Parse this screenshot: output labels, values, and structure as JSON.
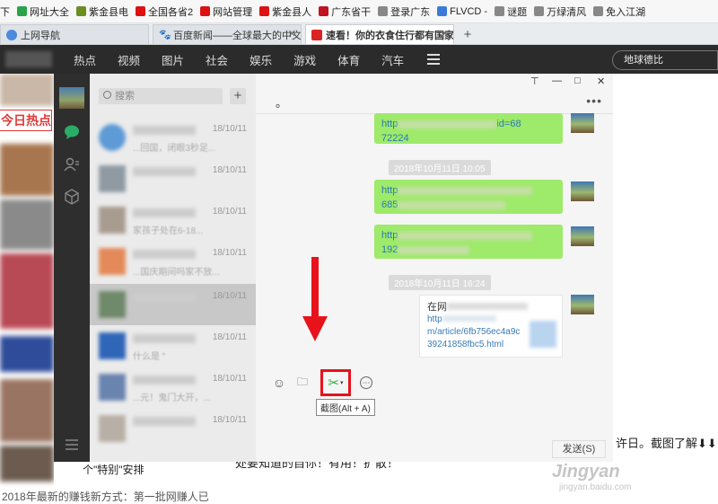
{
  "bookmarks": {
    "items": [
      {
        "label": "下",
        "color": "#e58a1f"
      },
      {
        "label": "网址大全",
        "color": "#2aa34a"
      },
      {
        "label": "紫金县电",
        "color": "#6b8e23"
      },
      {
        "label": "全国各省2",
        "color": "#d11"
      },
      {
        "label": "网站管理",
        "color": "#d11"
      },
      {
        "label": "紫金县人",
        "color": "#d11"
      },
      {
        "label": "广东省干",
        "color": "#c1121f"
      },
      {
        "label": "登录广东",
        "color": "#888"
      },
      {
        "label": "FLVCD -",
        "color": "#3b7bd8"
      },
      {
        "label": "谜题",
        "color": "#888"
      },
      {
        "label": "万绿清风",
        "color": "#888"
      },
      {
        "label": "免入江湖",
        "color": "#888"
      }
    ]
  },
  "tabs": {
    "items": [
      {
        "label": "上网导航",
        "active": false
      },
      {
        "label": "百度新闻——全球最大的中文新",
        "active": false
      },
      {
        "label": "速看！你的衣食住行都有国家标准",
        "active": true
      }
    ],
    "new_tab": "+"
  },
  "site_nav": {
    "items": [
      "热点",
      "视频",
      "图片",
      "社会",
      "娱乐",
      "游戏",
      "体育",
      "汽车"
    ],
    "search_placeholder": "地球德比"
  },
  "left_news": {
    "today_label": "今日热点",
    "bottom_lines": [
      "个\"特别\"安排",
      "2018年最新的赚钱新方式：第一批网赚人已"
    ]
  },
  "wechat": {
    "search_placeholder": "搜索",
    "add_label": "+",
    "chats": [
      {
        "time": "18/10/11",
        "preview": "...回国，闭眼3秒足..."
      },
      {
        "time": "18/10/11",
        "preview": ""
      },
      {
        "time": "18/10/11",
        "preview": "家孩子处在6-18..."
      },
      {
        "time": "18/10/11",
        "preview": "...国庆期间吗家不放..."
      },
      {
        "time": "18/10/11",
        "preview": ""
      },
      {
        "time": "18/10/11",
        "preview": "什么是 \""
      },
      {
        "time": "18/10/11",
        "preview": "...元！鬼门大开，..."
      },
      {
        "time": "18/10/11",
        "preview": ""
      }
    ],
    "window_controls": {
      "pin": "⊤",
      "min": "—",
      "max": "□",
      "close": "✕"
    },
    "chat_title": "。",
    "more": "•••",
    "messages": [
      {
        "type": "link",
        "text": "http",
        "suffix": "id=68",
        "line2": "72224"
      },
      {
        "type": "time",
        "text": "2018年10月11日 10:05"
      },
      {
        "type": "link",
        "text": "http",
        "line2": "685"
      },
      {
        "type": "link",
        "text": "http",
        "line2": "192"
      },
      {
        "type": "time",
        "text": "2018年10月11日 16:24"
      },
      {
        "type": "card",
        "title": "在网",
        "url_prefix": "http",
        "line2": "m/article/6fb756ec4a9c",
        "line3": "39241858fbc5.html"
      }
    ],
    "toolbar": {
      "emoji": "☺",
      "folder": "🗀",
      "cut": "✂",
      "chat_history": "⋯",
      "tooltip": "截图(Alt + A)"
    },
    "send_label": "发送(S)"
  },
  "page_bottom": {
    "right_text": "许日。截图了解⬇⬇日",
    "bottom_line": "处要知道的自你！有用！扩散！"
  },
  "watermark": {
    "main": "Jingyan",
    "sub": "jingyan.baidu.com"
  }
}
